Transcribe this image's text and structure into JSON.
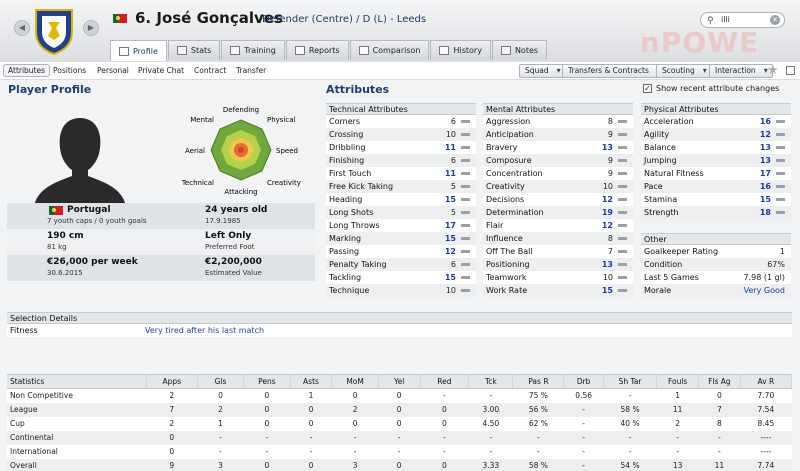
{
  "header": {
    "player_name": "6. José Gonçalves",
    "subtitle": "Defender (Centre) / D (L) - Leeds",
    "search_value": "illi",
    "watermark": "nPOWE"
  },
  "tabs": [
    {
      "label": "Profile"
    },
    {
      "label": "Stats"
    },
    {
      "label": "Training"
    },
    {
      "label": "Reports"
    },
    {
      "label": "Comparison"
    },
    {
      "label": "History"
    },
    {
      "label": "Notes"
    }
  ],
  "subtabs": [
    "Attributes",
    "Positions",
    "Personal",
    "Private Chat",
    "Contract",
    "Transfer"
  ],
  "toolbar": {
    "squad": "Squad",
    "transfers": "Transfers & Contracts",
    "scouting": "Scouting",
    "interaction": "Interaction"
  },
  "profile": {
    "title": "Player Profile",
    "nationality": "Portugal",
    "youth_caps": "7 youth caps / 0 youth goals",
    "age": "24 years old",
    "dob": "17.9.1985",
    "height": "190 cm",
    "weight": "81 kg",
    "foot": "Left Only",
    "foot_label": "Preferred Foot",
    "wage": "€26,000 per week",
    "contract_end": "30.6.2015",
    "value": "€2,200,000",
    "value_label": "Estimated Value"
  },
  "spider_labels": {
    "defending": "Defending",
    "physical": "Physical",
    "speed": "Speed",
    "creativity": "Creativity",
    "attacking": "Attacking",
    "technical": "Technical",
    "aerial": "Aerial",
    "mental": "Mental"
  },
  "attributes": {
    "title": "Attributes",
    "show_recent": "Show recent attribute changes",
    "technical": {
      "header": "Technical Attributes",
      "rows": [
        {
          "name": "Corners",
          "value": "6",
          "hi": false
        },
        {
          "name": "Crossing",
          "value": "10",
          "hi": false
        },
        {
          "name": "Dribbling",
          "value": "11",
          "hi": true
        },
        {
          "name": "Finishing",
          "value": "6",
          "hi": false
        },
        {
          "name": "First Touch",
          "value": "11",
          "hi": true
        },
        {
          "name": "Free Kick Taking",
          "value": "5",
          "hi": false
        },
        {
          "name": "Heading",
          "value": "15",
          "hi": true
        },
        {
          "name": "Long Shots",
          "value": "5",
          "hi": false
        },
        {
          "name": "Long Throws",
          "value": "17",
          "hi": true
        },
        {
          "name": "Marking",
          "value": "15",
          "hi": true
        },
        {
          "name": "Passing",
          "value": "12",
          "hi": true
        },
        {
          "name": "Penalty Taking",
          "value": "6",
          "hi": false
        },
        {
          "name": "Tackling",
          "value": "15",
          "hi": true
        },
        {
          "name": "Technique",
          "value": "10",
          "hi": false
        }
      ]
    },
    "mental": {
      "header": "Mental Attributes",
      "rows": [
        {
          "name": "Aggression",
          "value": "8",
          "hi": false
        },
        {
          "name": "Anticipation",
          "value": "9",
          "hi": false
        },
        {
          "name": "Bravery",
          "value": "13",
          "hi": true
        },
        {
          "name": "Composure",
          "value": "9",
          "hi": false
        },
        {
          "name": "Concentration",
          "value": "9",
          "hi": false
        },
        {
          "name": "Creativity",
          "value": "10",
          "hi": false
        },
        {
          "name": "Decisions",
          "value": "12",
          "hi": true
        },
        {
          "name": "Determination",
          "value": "19",
          "hi": true
        },
        {
          "name": "Flair",
          "value": "12",
          "hi": true
        },
        {
          "name": "Influence",
          "value": "8",
          "hi": false
        },
        {
          "name": "Off The Ball",
          "value": "7",
          "hi": false
        },
        {
          "name": "Positioning",
          "value": "13",
          "hi": true
        },
        {
          "name": "Teamwork",
          "value": "10",
          "hi": false
        },
        {
          "name": "Work Rate",
          "value": "15",
          "hi": true
        }
      ]
    },
    "physical": {
      "header": "Physical Attributes",
      "rows": [
        {
          "name": "Acceleration",
          "value": "16",
          "hi": true
        },
        {
          "name": "Agility",
          "value": "12",
          "hi": true
        },
        {
          "name": "Balance",
          "value": "13",
          "hi": true
        },
        {
          "name": "Jumping",
          "value": "13",
          "hi": true
        },
        {
          "name": "Natural Fitness",
          "value": "17",
          "hi": true
        },
        {
          "name": "Pace",
          "value": "16",
          "hi": true
        },
        {
          "name": "Stamina",
          "value": "15",
          "hi": true
        },
        {
          "name": "Strength",
          "value": "18",
          "hi": true
        }
      ]
    },
    "other": {
      "header": "Other",
      "rows": [
        {
          "name": "Goalkeeper Rating",
          "value": "1"
        },
        {
          "name": "Condition",
          "value": "67%"
        },
        {
          "name": "Last 5 Games",
          "value": "7.98 (1 gl)"
        },
        {
          "name": "Morale",
          "value": "Very Good"
        }
      ]
    }
  },
  "selection": {
    "header": "Selection Details",
    "fitness_label": "Fitness",
    "fitness_value": "Very tired after his last match"
  },
  "statistics": {
    "columns": [
      "Statistics",
      "Apps",
      "Gls",
      "Pens",
      "Asts",
      "MoM",
      "Yel",
      "Red",
      "Tck",
      "Pas R",
      "Drb",
      "Sh Tar",
      "Fouls",
      "Fls Ag",
      "Av R"
    ],
    "rows": [
      [
        "Non Competitive",
        "2",
        "0",
        "0",
        "1",
        "0",
        "0",
        "-",
        "-",
        "75 %",
        "0.56",
        "-",
        "1",
        "0",
        "7.70"
      ],
      [
        "League",
        "7",
        "2",
        "0",
        "0",
        "2",
        "0",
        "0",
        "3.00",
        "56 %",
        "-",
        "58 %",
        "11",
        "7",
        "7.54"
      ],
      [
        "Cup",
        "2",
        "1",
        "0",
        "0",
        "0",
        "0",
        "0",
        "4.50",
        "62 %",
        "-",
        "40 %",
        "2",
        "8",
        "8.45"
      ],
      [
        "Continental",
        "0",
        "-",
        "-",
        "-",
        "-",
        "-",
        "-",
        "-",
        "-",
        "-",
        "-",
        "-",
        "-",
        "----"
      ],
      [
        "International",
        "0",
        "-",
        "-",
        "-",
        "-",
        "-",
        "-",
        "-",
        "-",
        "-",
        "-",
        "-",
        "-",
        "----"
      ],
      [
        "Overall",
        "9",
        "3",
        "0",
        "0",
        "3",
        "0",
        "0",
        "3.33",
        "58 %",
        "-",
        "54 %",
        "13",
        "11",
        "7.74"
      ]
    ]
  }
}
